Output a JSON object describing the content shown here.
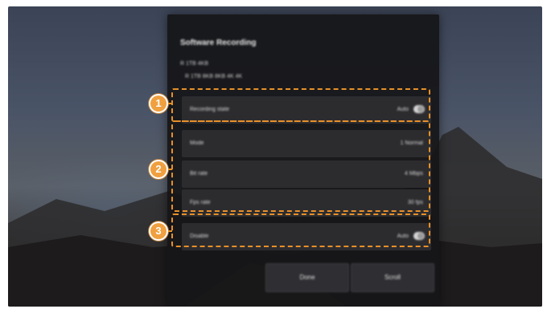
{
  "dialog": {
    "title": "Software Recording",
    "info_line1": "R 1TB 4KB",
    "info_line2": "R 1TB 8KB 8KB 4K 4K",
    "settings": [
      {
        "label": "Recording state",
        "value": "Auto"
      },
      {
        "label": "Mode",
        "value": "1 Normal"
      },
      {
        "label": "Bit rate",
        "value": "4 Mbps"
      },
      {
        "label": "Fps rate",
        "value": "30 fps"
      },
      {
        "label": "Disable",
        "value": "Auto"
      }
    ],
    "buttons": {
      "left": "Done",
      "right": "Scroll"
    }
  },
  "callouts": [
    {
      "number": "1"
    },
    {
      "number": "2"
    },
    {
      "number": "3"
    }
  ],
  "colors": {
    "callout": "#e8902a",
    "marker": "#f0a040",
    "dialog": "#161618"
  }
}
